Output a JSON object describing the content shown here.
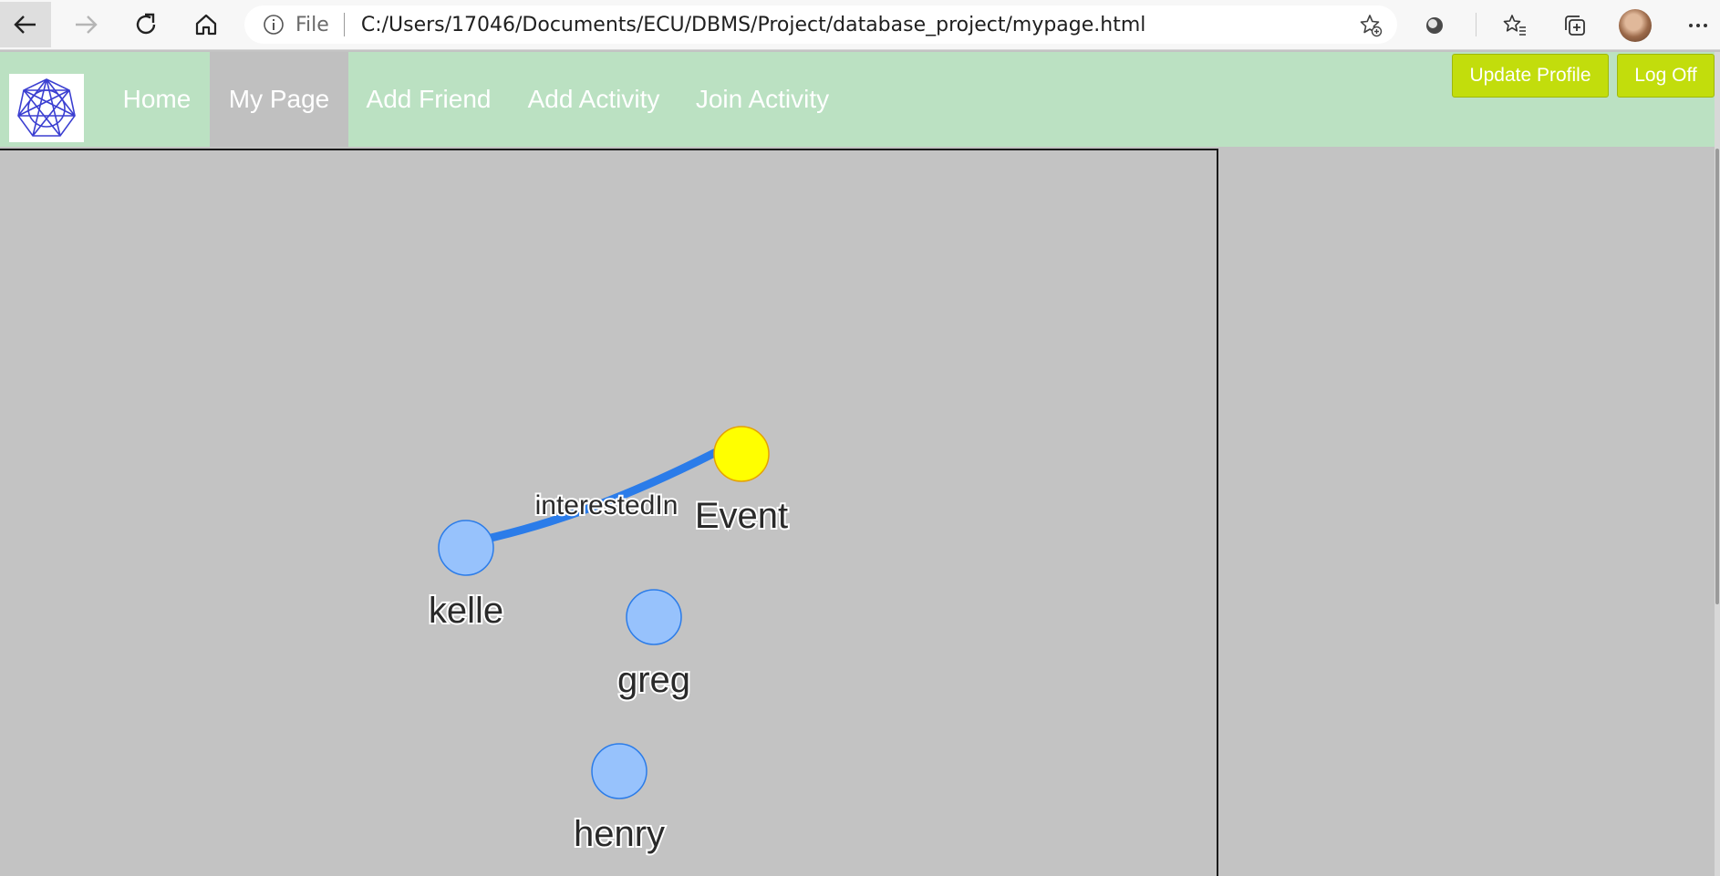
{
  "browser": {
    "address_scheme": "File",
    "url": "C:/Users/17046/Documents/ECU/DBMS/Project/database_project/mypage.html"
  },
  "nav": {
    "items": [
      {
        "label": "Home",
        "active": false
      },
      {
        "label": "My Page",
        "active": true
      },
      {
        "label": "Add Friend",
        "active": false
      },
      {
        "label": "Add Activity",
        "active": false
      },
      {
        "label": "Join Activity",
        "active": false
      }
    ],
    "update_profile_label": "Update Profile",
    "log_off_label": "Log Off"
  },
  "colors": {
    "nav_background": "#bbe1c2",
    "button_green": "#c2dd0c",
    "node_person": "#97c2fc",
    "node_person_border": "#2b7ce9",
    "node_event": "#ffff00",
    "node_event_border": "#e5a200",
    "edge": "#2b7ce9",
    "canvas": "#c3c3c3"
  },
  "graph": {
    "nodes": [
      {
        "id": "event",
        "label": "Event",
        "kind": "event"
      },
      {
        "id": "kelle",
        "label": "kelle",
        "kind": "person"
      },
      {
        "id": "greg",
        "label": "greg",
        "kind": "person"
      },
      {
        "id": "henry",
        "label": "henry",
        "kind": "person"
      }
    ],
    "edges": [
      {
        "from": "kelle",
        "to": "event",
        "label": "interestedIn"
      }
    ]
  }
}
